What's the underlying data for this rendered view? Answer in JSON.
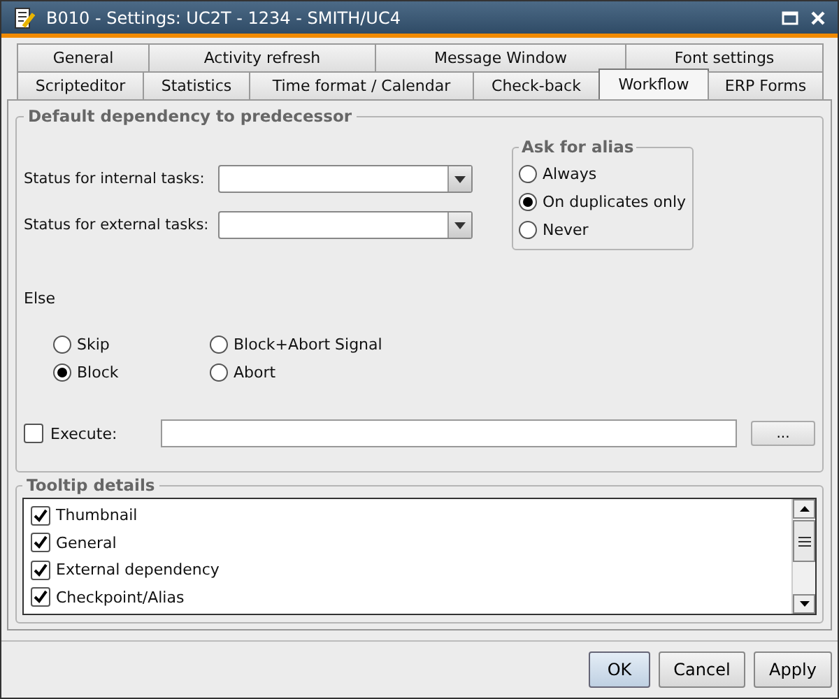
{
  "window": {
    "title": "B010 - Settings: UC2T - 1234 - SMITH/UC4"
  },
  "tab_rows": [
    [
      {
        "label": "General",
        "selected": false
      },
      {
        "label": "Activity refresh",
        "selected": false
      },
      {
        "label": "Message Window",
        "selected": false
      },
      {
        "label": "Font settings",
        "selected": false
      }
    ],
    [
      {
        "label": "Scripteditor",
        "selected": false
      },
      {
        "label": "Statistics",
        "selected": false
      },
      {
        "label": "Time format / Calendar",
        "selected": false
      },
      {
        "label": "Check-back",
        "selected": false
      },
      {
        "label": "Workflow",
        "selected": true
      },
      {
        "label": "ERP Forms",
        "selected": false
      }
    ]
  ],
  "dependency": {
    "title": "Default dependency to predecessor",
    "fields": [
      {
        "label": "Status for internal tasks:"
      },
      {
        "label": "Status for external tasks:"
      }
    ],
    "alias": {
      "title": "Ask for alias",
      "options": [
        {
          "label": "Always",
          "selected": false
        },
        {
          "label": "On duplicates only",
          "selected": true
        },
        {
          "label": "Never",
          "selected": false
        }
      ]
    },
    "else_label": "Else",
    "else_options": [
      {
        "label": "Skip",
        "selected": false
      },
      {
        "label": "Block+Abort Signal",
        "selected": false
      },
      {
        "label": "Block",
        "selected": true
      },
      {
        "label": "Abort",
        "selected": false
      }
    ],
    "execute": {
      "label": "Execute:",
      "checked": false,
      "browse": "..."
    }
  },
  "tooltip": {
    "title": "Tooltip details",
    "items": [
      {
        "label": "Thumbnail",
        "checked": true
      },
      {
        "label": "General",
        "checked": true
      },
      {
        "label": "External dependency",
        "checked": true
      },
      {
        "label": "Checkpoint/Alias",
        "checked": true
      }
    ]
  },
  "buttons": [
    {
      "label": "OK",
      "kind": "default"
    },
    {
      "label": "Cancel",
      "kind": "normal"
    },
    {
      "label": "Apply",
      "kind": "normal"
    }
  ]
}
